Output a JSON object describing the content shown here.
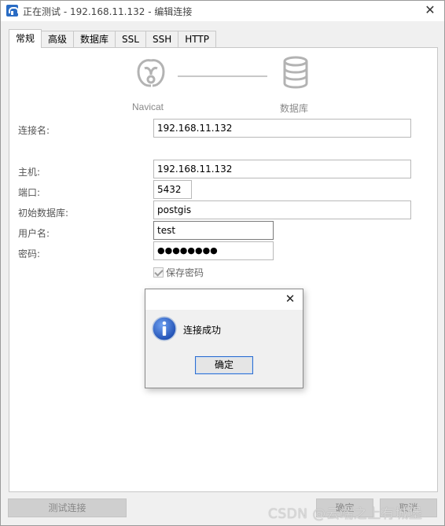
{
  "window": {
    "title": "正在测试 - 192.168.11.132 - 编辑连接",
    "close_glyph": "✕"
  },
  "tabs": [
    {
      "label": "常规",
      "active": true
    },
    {
      "label": "高级",
      "active": false
    },
    {
      "label": "数据库",
      "active": false
    },
    {
      "label": "SSL",
      "active": false
    },
    {
      "label": "SSH",
      "active": false
    },
    {
      "label": "HTTP",
      "active": false
    }
  ],
  "diagram": {
    "left_label": "Navicat",
    "right_label": "数据库",
    "left_icon": "navicat-logo-icon",
    "right_icon": "database-icon"
  },
  "form": {
    "connection_name": {
      "label": "连接名:",
      "value": "192.168.11.132"
    },
    "host": {
      "label": "主机:",
      "value": "192.168.11.132"
    },
    "port": {
      "label": "端口:",
      "value": "5432"
    },
    "initial_db": {
      "label": "初始数据库:",
      "value": "postgis"
    },
    "username": {
      "label": "用户名:",
      "value": "test"
    },
    "password": {
      "label": "密码:",
      "value": "●●●●●●●●"
    },
    "save_password": {
      "label": "保存密码",
      "checked": true
    }
  },
  "buttons": {
    "test_connection": "测试连接",
    "ok_partial": "确定",
    "cancel_partial": "取消"
  },
  "dialog": {
    "message": "连接成功",
    "ok_label": "确定",
    "close_glyph": "✕",
    "icon": "info-icon"
  },
  "watermark": "CSDN @云端之上有城堡",
  "colors": {
    "accent": "#2e6fd0",
    "info_icon": "#1f57c7"
  }
}
